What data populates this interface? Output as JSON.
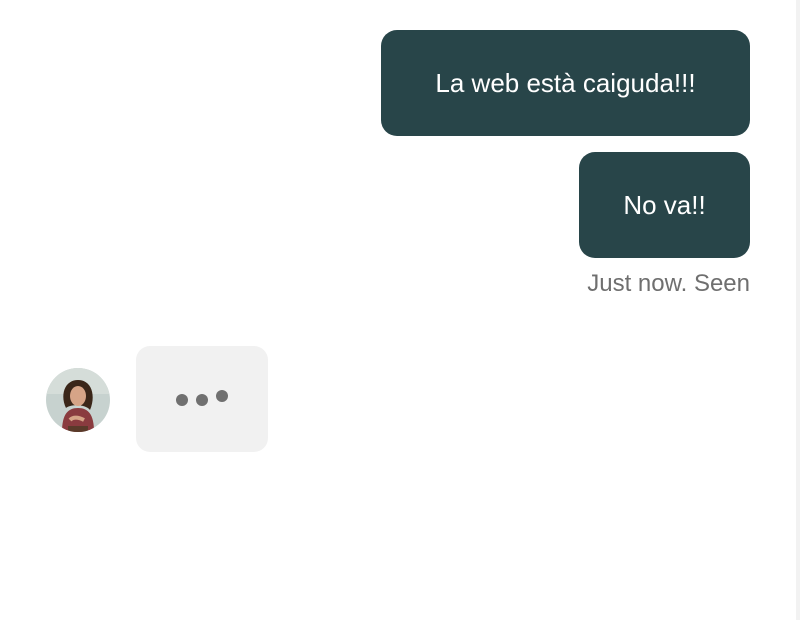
{
  "conversation": {
    "messages": [
      {
        "direction": "outgoing",
        "text": "La web està caiguda!!!"
      },
      {
        "direction": "outgoing",
        "text": "No va!!"
      }
    ],
    "status": "Just now. Seen",
    "typing_indicator": {
      "dots": 3,
      "from": "avatar"
    }
  },
  "colors": {
    "outgoing_bubble": "#284549",
    "outgoing_text": "#ffffff",
    "typing_bubble": "#f1f1f1",
    "typing_dots": "#707070",
    "status_text": "#6f6f6f"
  }
}
